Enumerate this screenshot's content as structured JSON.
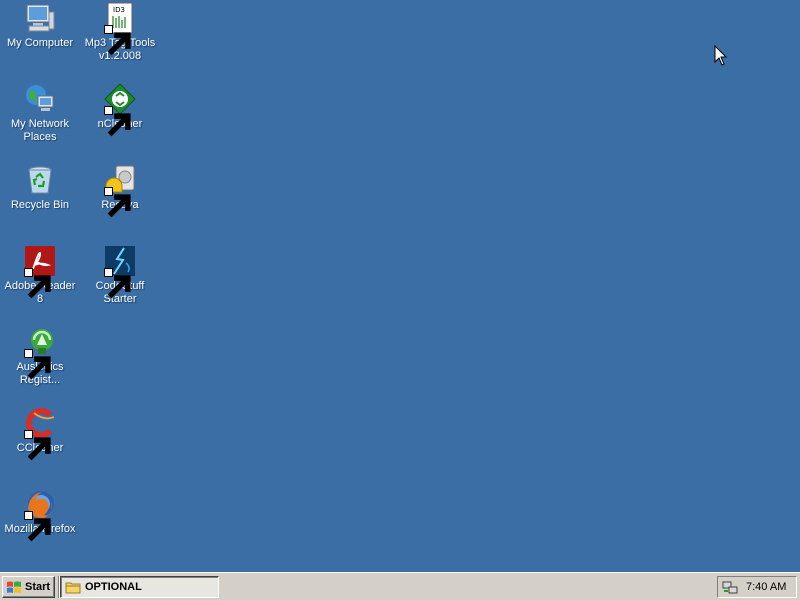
{
  "desktop": {
    "background_color": "#3a6ea5",
    "icons": [
      {
        "label": "My Computer",
        "icon": "my-computer-icon"
      },
      {
        "label": "Mp3 Tag Tools v1.2.008",
        "icon": "mp3-tag-tools-icon",
        "badge_text": "ID3"
      },
      {
        "label": "My Network Places",
        "icon": "network-places-icon"
      },
      {
        "label": "nCleaner",
        "icon": "ncleaner-icon"
      },
      {
        "label": "Recycle Bin",
        "icon": "recycle-bin-icon"
      },
      {
        "label": "Recuva",
        "icon": "recuva-icon"
      },
      {
        "label": "Adobe Reader 8",
        "icon": "adobe-reader-icon"
      },
      {
        "label": "CodeStuff Starter",
        "icon": "codestuff-starter-icon"
      },
      {
        "label": "Auslogics Regist...",
        "icon": "auslogics-icon"
      },
      {
        "label": "CCleaner",
        "icon": "ccleaner-icon"
      },
      {
        "label": "Mozilla Firefox",
        "icon": "firefox-icon"
      }
    ]
  },
  "taskbar": {
    "start_label": "Start",
    "tasks": [
      {
        "label": "OPTIONAL",
        "icon": "folder-icon",
        "active": true
      }
    ],
    "tray": {
      "clock": "7:40 AM",
      "icons": [
        "network-tray-icon"
      ]
    }
  }
}
